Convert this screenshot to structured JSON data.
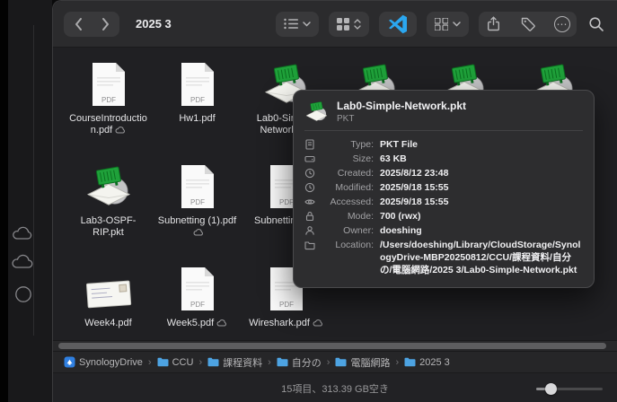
{
  "window": {
    "title": "2025 3"
  },
  "labels": {
    "pdf_badge": "PDF",
    "ellipsis": "⋯"
  },
  "files": [
    {
      "name": "CourseIntroduction.pdf",
      "kind": "pdf",
      "cloud": true
    },
    {
      "name": "Hw1.pdf",
      "kind": "pdf",
      "cloud": false
    },
    {
      "name": "Lab0-Simple-Network.pkt",
      "kind": "pkt",
      "cloud": false
    },
    {
      "name": "",
      "kind": "pkt",
      "cloud": false
    },
    {
      "name": "",
      "kind": "pkt",
      "cloud": false
    },
    {
      "name": "",
      "kind": "pkt",
      "cloud": false
    },
    {
      "name": "Lab3-OSPF-RIP.pkt",
      "kind": "pkt",
      "cloud": false
    },
    {
      "name": "Subnetting (1).pdf",
      "kind": "pdf",
      "cloud": true
    },
    {
      "name": "Subnetting.pdf",
      "kind": "pdf",
      "cloud": false
    },
    {
      "name": "Week4.pdf",
      "kind": "letter",
      "cloud": false
    },
    {
      "name": "Week5.pdf",
      "kind": "pdf",
      "cloud": true
    },
    {
      "name": "Wireshark.pdf",
      "kind": "pdf",
      "cloud": true
    }
  ],
  "popover": {
    "title": "Lab0-Simple-Network.pkt",
    "subtitle": "PKT",
    "rows": [
      {
        "label": "Type:",
        "value": "PKT File"
      },
      {
        "label": "Size:",
        "value": "63 KB"
      },
      {
        "label": "Created:",
        "value": "2025/8/12 23:48"
      },
      {
        "label": "Modified:",
        "value": "2025/9/18 15:55"
      },
      {
        "label": "Accessed:",
        "value": "2025/9/18 15:55"
      },
      {
        "label": "Mode:",
        "value": "700 (rwx)"
      },
      {
        "label": "Owner:",
        "value": "doeshing"
      },
      {
        "label": "Location:",
        "value": "/Users/doeshing/Library/CloudStorage/SynologyDrive-MBP20250812/CCU/課程資料/自分の/電腦網路/2025 3/Lab0-Simple-Network.pkt"
      }
    ]
  },
  "pathbar": {
    "separator": "›",
    "items": [
      "SynologyDrive",
      "CCU",
      "課程資料",
      "自分の",
      "電腦網路",
      "2025 3"
    ]
  },
  "statusbar": {
    "text": "15項目、313.39 GB空き"
  }
}
